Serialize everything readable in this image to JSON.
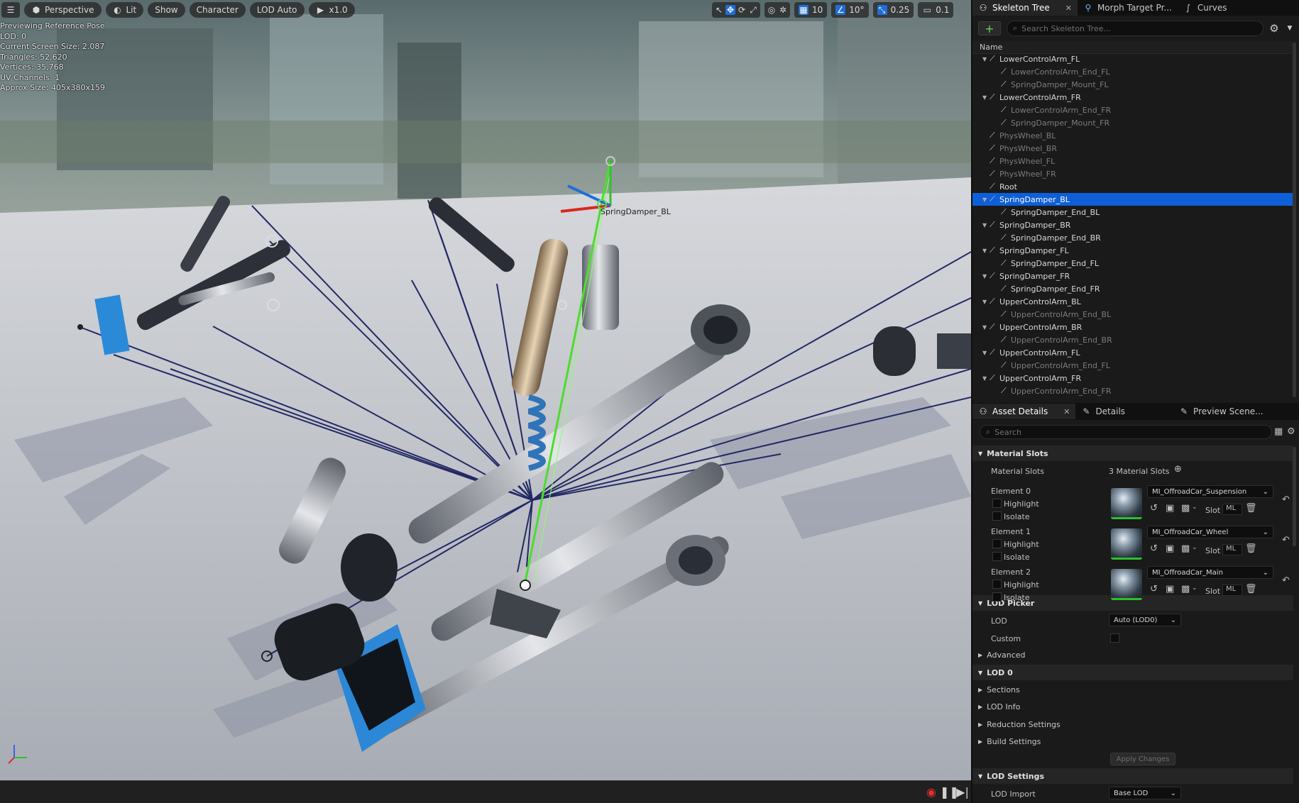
{
  "viewport": {
    "toolbar": {
      "perspective": "Perspective",
      "lit": "Lit",
      "show": "Show",
      "character": "Character",
      "lod": "LOD Auto",
      "speed": "x1.0"
    },
    "right_toolbar": {
      "grid": "10",
      "angle": "10°",
      "scale": "0.25",
      "camera": "0.1"
    },
    "stats": [
      "Previewing Reference Pose",
      "LOD: 0",
      "Current Screen Size: 2.087",
      "Triangles: 52,620",
      "Vertices: 35,768",
      "UV Channels: 1",
      "Approx Size: 405x380x159"
    ],
    "bone_label": "SpringDamper_BL"
  },
  "skeleton_tabs": [
    {
      "label": "Skeleton Tree",
      "icon": "skeleton-icon"
    },
    {
      "label": "Morph Target Pr...",
      "icon": "morph-icon"
    },
    {
      "label": "Curves",
      "icon": "curve-icon"
    }
  ],
  "skeleton_search_placeholder": "Search Skeleton Tree...",
  "tree_header": "Name",
  "tree": [
    {
      "label": "LowerControlArm_FL",
      "level": 1,
      "expanded": true,
      "dim": false
    },
    {
      "label": "LowerControlArm_End_FL",
      "level": 2,
      "dim": true
    },
    {
      "label": "SpringDamper_Mount_FL",
      "level": 2,
      "dim": true
    },
    {
      "label": "LowerControlArm_FR",
      "level": 1,
      "expanded": true,
      "dim": false
    },
    {
      "label": "LowerControlArm_End_FR",
      "level": 2,
      "dim": true
    },
    {
      "label": "SpringDamper_Mount_FR",
      "level": 2,
      "dim": true
    },
    {
      "label": "PhysWheel_BL",
      "level": 1,
      "dim": true
    },
    {
      "label": "PhysWheel_BR",
      "level": 1,
      "dim": true
    },
    {
      "label": "PhysWheel_FL",
      "level": 1,
      "dim": true
    },
    {
      "label": "PhysWheel_FR",
      "level": 1,
      "dim": true
    },
    {
      "label": "Root",
      "level": 1,
      "dim": false
    },
    {
      "label": "SpringDamper_BL",
      "level": 1,
      "expanded": true,
      "selected": true
    },
    {
      "label": "SpringDamper_End_BL",
      "level": 2,
      "dim": false
    },
    {
      "label": "SpringDamper_BR",
      "level": 1,
      "expanded": true,
      "dim": false
    },
    {
      "label": "SpringDamper_End_BR",
      "level": 2,
      "dim": false
    },
    {
      "label": "SpringDamper_FL",
      "level": 1,
      "expanded": true,
      "dim": false
    },
    {
      "label": "SpringDamper_End_FL",
      "level": 2,
      "dim": false
    },
    {
      "label": "SpringDamper_FR",
      "level": 1,
      "expanded": true,
      "dim": false
    },
    {
      "label": "SpringDamper_End_FR",
      "level": 2,
      "dim": false
    },
    {
      "label": "UpperControlArm_BL",
      "level": 1,
      "expanded": true,
      "dim": false
    },
    {
      "label": "UpperControlArm_End_BL",
      "level": 2,
      "dim": true
    },
    {
      "label": "UpperControlArm_BR",
      "level": 1,
      "expanded": true,
      "dim": false
    },
    {
      "label": "UpperControlArm_End_BR",
      "level": 2,
      "dim": true
    },
    {
      "label": "UpperControlArm_FL",
      "level": 1,
      "expanded": true,
      "dim": false
    },
    {
      "label": "UpperControlArm_End_FL",
      "level": 2,
      "dim": true
    },
    {
      "label": "UpperControlArm_FR",
      "level": 1,
      "expanded": true,
      "dim": false
    },
    {
      "label": "UpperControlArm_End_FR",
      "level": 2,
      "dim": true
    }
  ],
  "details_tabs": [
    {
      "label": "Asset Details",
      "icon": "asset-icon"
    },
    {
      "label": "Details",
      "icon": "pencil-icon"
    },
    {
      "label": "Preview Scene...",
      "icon": "brush-icon"
    }
  ],
  "details_search_placeholder": "Search",
  "material_slots": {
    "section": "Material Slots",
    "label": "Material Slots",
    "count": "3 Material Slots",
    "elements": [
      {
        "name": "Element 0",
        "highlight": "Highlight",
        "isolate": "Isolate",
        "material": "MI_OffroadCar_Suspension",
        "slot": "Slot",
        "slot_value": "ML"
      },
      {
        "name": "Element 1",
        "highlight": "Highlight",
        "isolate": "Isolate",
        "material": "MI_OffroadCar_Wheel",
        "slot": "Slot",
        "slot_value": "ML"
      },
      {
        "name": "Element 2",
        "highlight": "Highlight",
        "isolate": "Isolate",
        "material": "MI_OffroadCar_Main",
        "slot": "Slot",
        "slot_value": "ML"
      }
    ]
  },
  "lod_picker": {
    "section": "LOD Picker",
    "lod_label": "LOD",
    "lod_value": "Auto (LOD0)",
    "custom_label": "Custom",
    "advanced": "Advanced"
  },
  "lod0": {
    "section": "LOD 0",
    "sections": "Sections",
    "lod_info": "LOD Info",
    "reduction": "Reduction Settings",
    "build": "Build Settings",
    "apply": "Apply Changes"
  },
  "lod_settings": {
    "section": "LOD Settings",
    "lod_import_label": "LOD Import",
    "lod_import_value": "Base LOD"
  },
  "colors": {
    "selection": "#0e5fd8",
    "accent_green": "#2cbf2c",
    "accent_blue": "#1f6ed6",
    "wire": "#1a1f5c"
  }
}
